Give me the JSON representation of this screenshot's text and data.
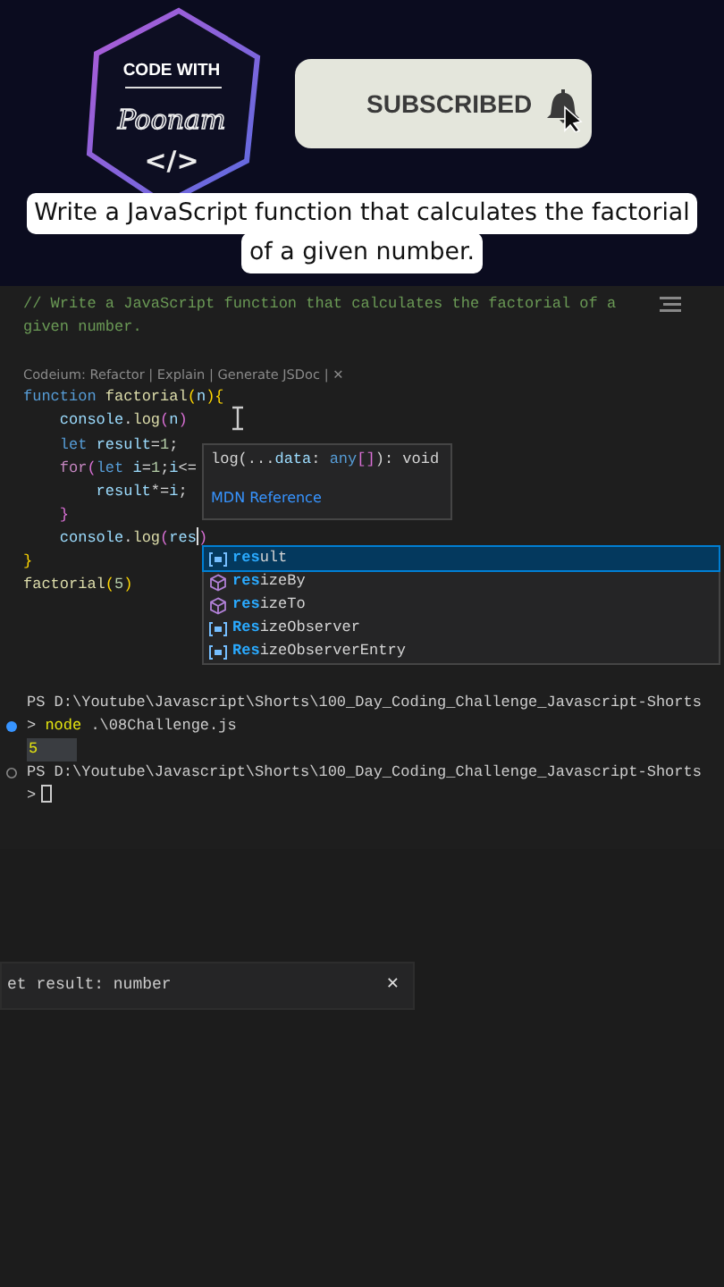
{
  "channel_logo": {
    "line_1": "CODE WITH",
    "signature": "Poonam",
    "symbol": "</>"
  },
  "subscribe_button": {
    "label": "SUBSCRIBED"
  },
  "caption": [
    "Write a JavaScript function that calculates the factorial",
    "of a given number."
  ],
  "editor": {
    "lines": [
      {
        "kind": "code",
        "tokens": [
          {
            "kind": "comment",
            "text": "// Write a JavaScript function that calculates the factorial of a"
          }
        ]
      },
      {
        "kind": "code",
        "tokens": [
          {
            "kind": "comment",
            "text": "given number."
          }
        ]
      },
      {
        "kind": "blank"
      },
      {
        "kind": "codelens",
        "text": "Codeium: Refactor | Explain | Generate JSDoc | ✕"
      },
      {
        "kind": "code",
        "tokens": [
          {
            "kind": "keyword",
            "text": "function "
          },
          {
            "kind": "func",
            "text": "factorial"
          },
          {
            "kind": "bracket",
            "text": "("
          },
          {
            "kind": "var",
            "text": "n"
          },
          {
            "kind": "bracket",
            "text": "){"
          }
        ]
      },
      {
        "kind": "code",
        "tokens": [
          {
            "kind": "var",
            "text": "    console"
          },
          {
            "kind": "plain",
            "text": "."
          },
          {
            "kind": "func",
            "text": "log"
          },
          {
            "kind": "bracket2",
            "text": "("
          },
          {
            "kind": "var",
            "text": "n"
          },
          {
            "kind": "bracket2",
            "text": ")"
          }
        ]
      },
      {
        "kind": "code",
        "tokens": [
          {
            "kind": "keyword",
            "text": "    let "
          },
          {
            "kind": "var",
            "text": "result"
          },
          {
            "kind": "plain",
            "text": "="
          },
          {
            "kind": "number",
            "text": "1"
          },
          {
            "kind": "plain",
            "text": ";"
          }
        ]
      },
      {
        "kind": "code",
        "tokens": [
          {
            "kind": "control",
            "text": "    for"
          },
          {
            "kind": "bracket2",
            "text": "("
          },
          {
            "kind": "keyword",
            "text": "let "
          },
          {
            "kind": "var",
            "text": "i"
          },
          {
            "kind": "plain",
            "text": "="
          },
          {
            "kind": "number",
            "text": "1"
          },
          {
            "kind": "plain",
            "text": ";"
          },
          {
            "kind": "var",
            "text": "i"
          },
          {
            "kind": "plain",
            "text": "<="
          }
        ]
      },
      {
        "kind": "code",
        "tokens": [
          {
            "kind": "var",
            "text": "        result"
          },
          {
            "kind": "plain",
            "text": "*="
          },
          {
            "kind": "var",
            "text": "i"
          },
          {
            "kind": "plain",
            "text": ";"
          }
        ]
      },
      {
        "kind": "code",
        "tokens": [
          {
            "kind": "bracket2",
            "text": "    }"
          }
        ]
      },
      {
        "kind": "code",
        "tokens": [
          {
            "kind": "var",
            "text": "    console"
          },
          {
            "kind": "plain",
            "text": "."
          },
          {
            "kind": "func",
            "text": "log"
          },
          {
            "kind": "bracket2",
            "text": "("
          },
          {
            "kind": "var",
            "text": "res"
          },
          {
            "kind": "cursor"
          },
          {
            "kind": "bracket2",
            "text": ")"
          }
        ]
      },
      {
        "kind": "code",
        "tokens": [
          {
            "kind": "bracket",
            "text": "}"
          }
        ]
      },
      {
        "kind": "code",
        "tokens": [
          {
            "kind": "func",
            "text": "factorial"
          },
          {
            "kind": "bracket",
            "text": "("
          },
          {
            "kind": "number",
            "text": "5"
          },
          {
            "kind": "bracket",
            "text": ")"
          }
        ]
      }
    ],
    "parameter_hint": {
      "tokens": [
        {
          "kind": "plain",
          "text": "log(..."
        },
        {
          "kind": "var",
          "text": "data"
        },
        {
          "kind": "plain",
          "text": ": "
        },
        {
          "kind": "keyword",
          "text": "any"
        },
        {
          "kind": "bracket2",
          "text": "[]"
        },
        {
          "kind": "plain",
          "text": "): void"
        }
      ],
      "link": "MDN Reference"
    },
    "suggestions": [
      {
        "label": "**res**ult",
        "kind": "variable",
        "selected": true
      },
      {
        "label": "**res**izeBy",
        "kind": "method",
        "selected": false
      },
      {
        "label": "**res**izeTo",
        "kind": "method",
        "selected": false
      },
      {
        "label": "**Res**izeObserver",
        "kind": "variable",
        "selected": false
      },
      {
        "label": "**Res**izeObserverEntry",
        "kind": "variable",
        "selected": false
      }
    ]
  },
  "terminal": {
    "lines": [
      {
        "kind": "path",
        "text": "PS D:\\Youtube\\Javascript\\Shorts\\100_Day_Coding_Challenge_Javascript-Shorts"
      },
      {
        "kind": "command_done",
        "prompt": ">",
        "command": "node",
        "args": " .\\08Challenge.js"
      },
      {
        "kind": "output",
        "text": "5"
      },
      {
        "kind": "path_idle",
        "text": "PS D:\\Youtube\\Javascript\\Shorts\\100_Day_Coding_Challenge_Javascript-Shorts"
      },
      {
        "kind": "input",
        "prompt": ">"
      }
    ]
  },
  "hover": {
    "text": "et result: number",
    "close": "✕"
  }
}
